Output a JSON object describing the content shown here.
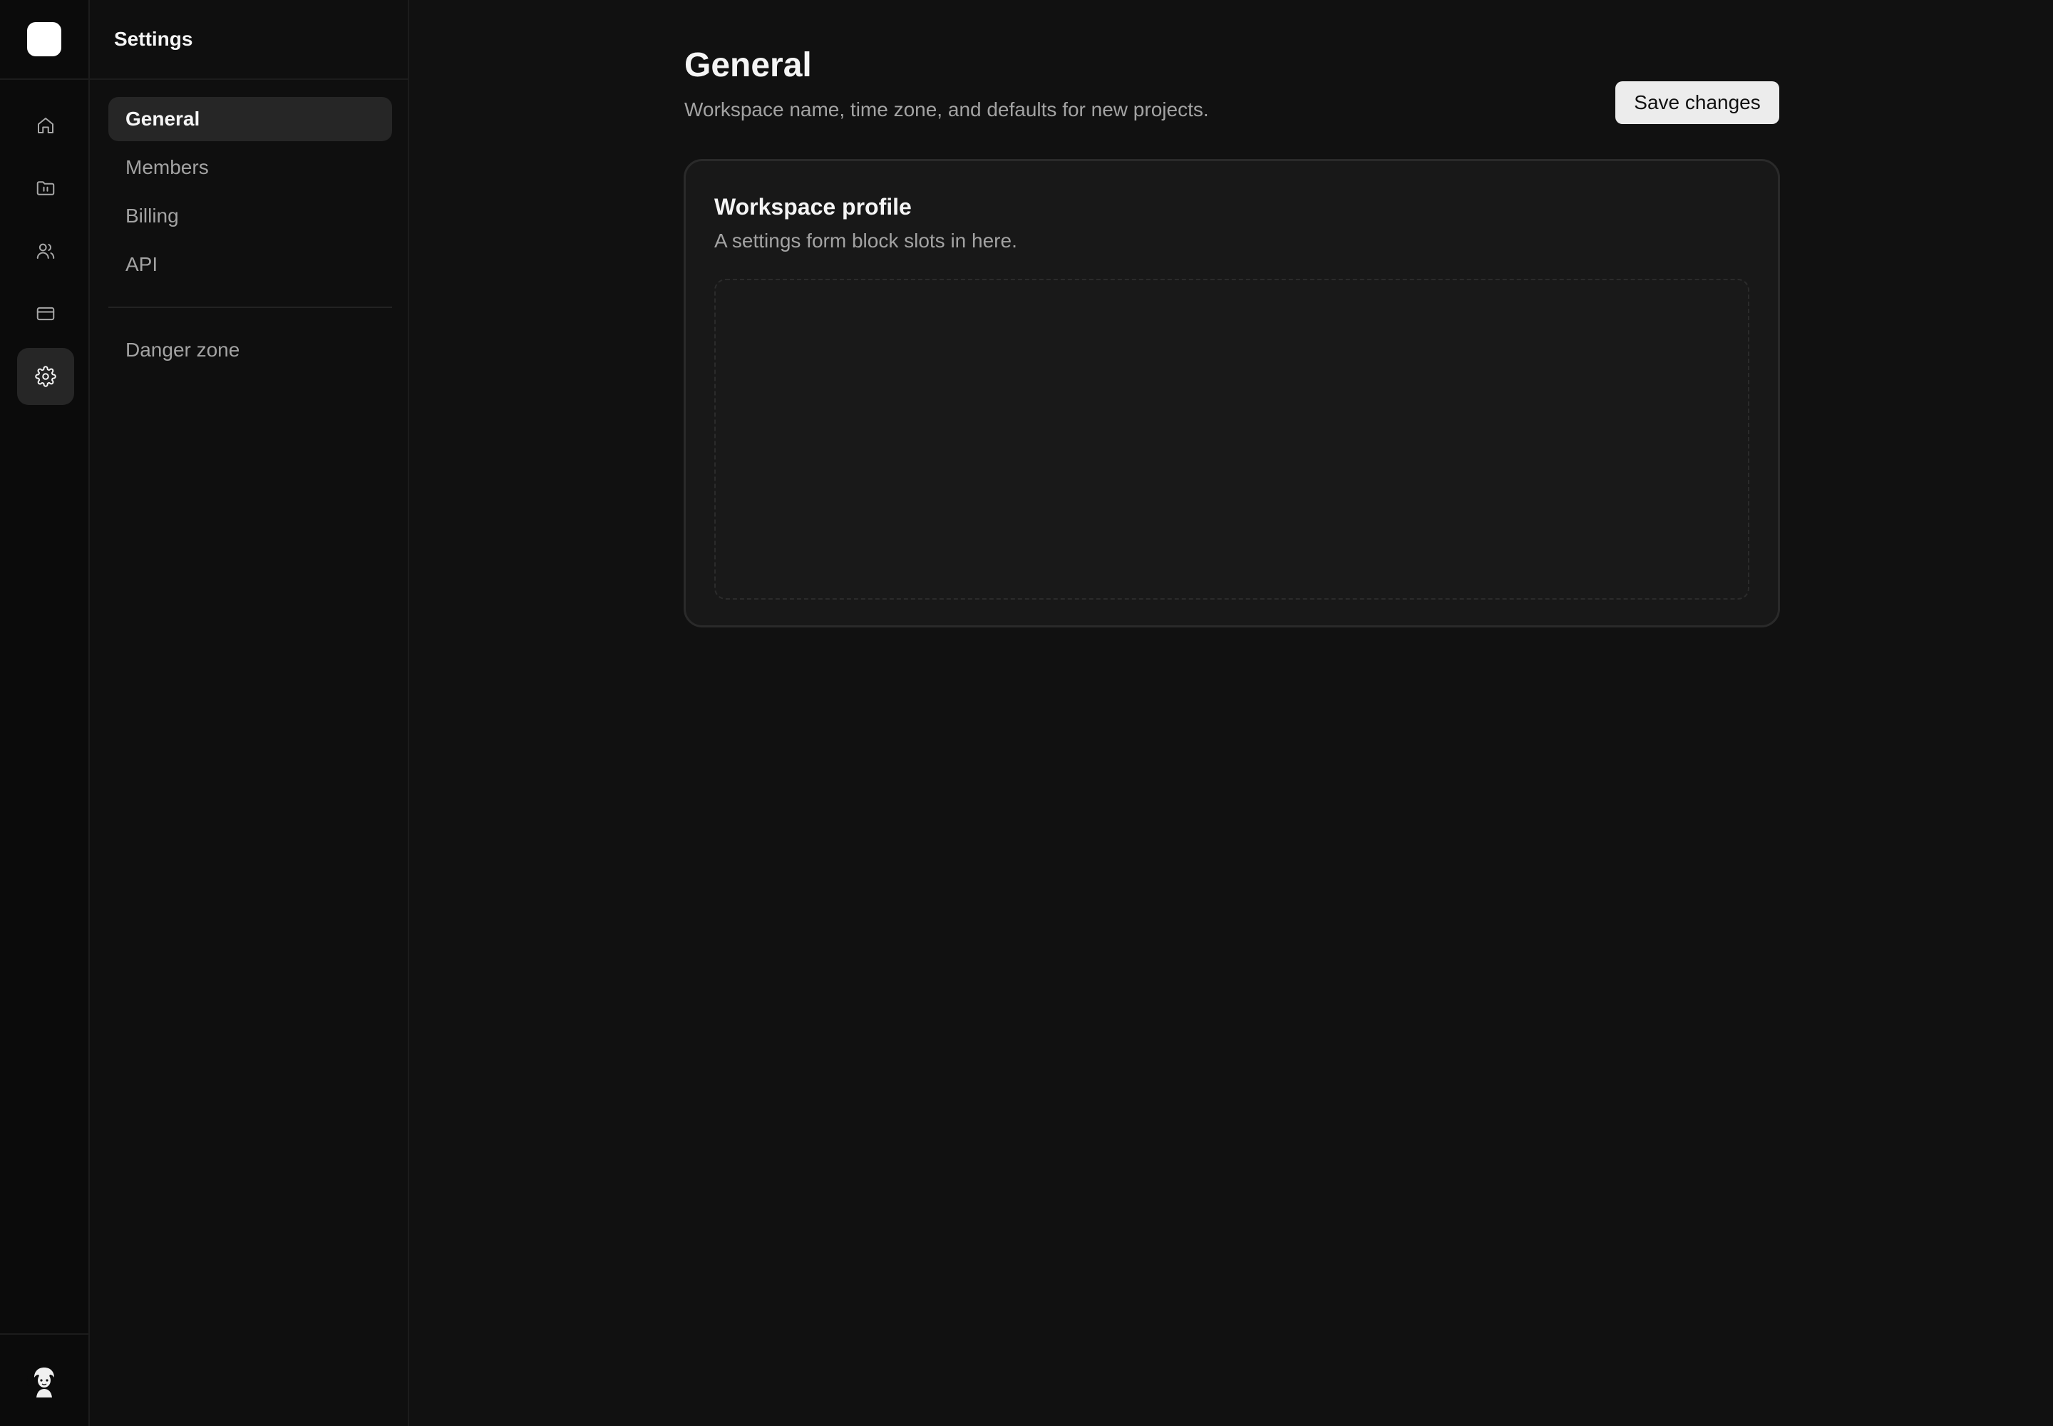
{
  "rail": {
    "items": [
      {
        "icon": "home-icon",
        "label": "Home"
      },
      {
        "icon": "folder-icon",
        "label": "Projects"
      },
      {
        "icon": "users-icon",
        "label": "Members"
      },
      {
        "icon": "credit-card-icon",
        "label": "Billing"
      },
      {
        "icon": "gear-icon",
        "label": "Settings",
        "active": true
      }
    ]
  },
  "sidebar": {
    "title": "Settings",
    "items": [
      {
        "label": "General",
        "active": true
      },
      {
        "label": "Members"
      },
      {
        "label": "Billing"
      },
      {
        "label": "API"
      }
    ],
    "danger_label": "Danger zone"
  },
  "main": {
    "title": "General",
    "subtitle": "Workspace name, time zone, and defaults for new projects.",
    "save_label": "Save changes",
    "card": {
      "title": "Workspace profile",
      "description": "A settings form block slots in here."
    }
  },
  "colors": {
    "background": "#111111",
    "rail": "#0b0b0b",
    "sidebar": "#0f0f0f",
    "active_item": "#262626",
    "button": "#ececec",
    "card": "#181818"
  }
}
